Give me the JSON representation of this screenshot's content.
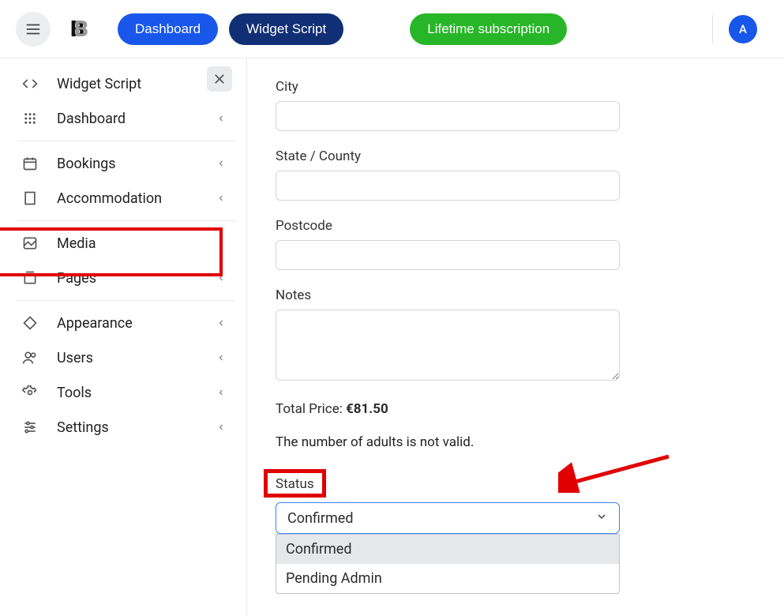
{
  "header": {
    "dashboard_label": "Dashboard",
    "widget_script_label": "Widget Script",
    "lifetime_label": "Lifetime subscription",
    "avatar_initial": "A"
  },
  "sidebar": {
    "items": [
      {
        "label": "Widget Script",
        "icon": "code",
        "has_chevron": false
      },
      {
        "label": "Dashboard",
        "icon": "grid",
        "has_chevron": true
      },
      {
        "label": "Bookings",
        "icon": "calendar",
        "has_chevron": true
      },
      {
        "label": "Accommodation",
        "icon": "building",
        "has_chevron": true
      },
      {
        "label": "Media",
        "icon": "image",
        "has_chevron": true
      },
      {
        "label": "Pages",
        "icon": "layers",
        "has_chevron": true
      },
      {
        "label": "Appearance",
        "icon": "paint",
        "has_chevron": true
      },
      {
        "label": "Users",
        "icon": "users",
        "has_chevron": true
      },
      {
        "label": "Tools",
        "icon": "gear",
        "has_chevron": true
      },
      {
        "label": "Settings",
        "icon": "sliders",
        "has_chevron": true
      }
    ]
  },
  "form": {
    "city_label": "City",
    "city_value": "",
    "state_label": "State / County",
    "state_value": "",
    "postcode_label": "Postcode",
    "postcode_value": "",
    "notes_label": "Notes",
    "notes_value": "",
    "total_price_label": "Total Price: ",
    "total_price_value": "€81.50",
    "validation_msg": "The number of adults is not valid.",
    "status_label": "Status",
    "status_selected": "Confirmed",
    "status_options": [
      "Confirmed",
      "Pending Admin"
    ]
  }
}
